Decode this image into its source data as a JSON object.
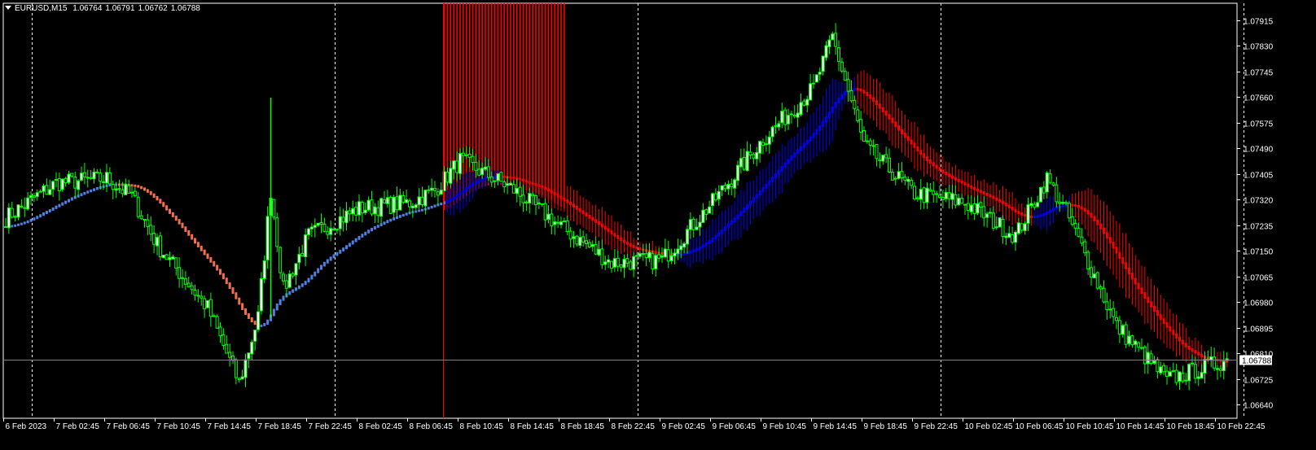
{
  "header": {
    "symbol": "EURUSD,M15",
    "open": "1.06764",
    "high": "1.06791",
    "low": "1.06762",
    "close": "1.06788"
  },
  "colors": {
    "background": "#000000",
    "bull_outline": "#00ff00",
    "bull_fill": "#ffffff",
    "ma_up": "#0000ff",
    "ma_down": "#ff0000",
    "ma_up_light": "#4f7fe0",
    "ma_down_light": "#f07050",
    "axis": "#ffffff",
    "current_line": "#808080",
    "signal_line": "#ff0000"
  },
  "chart_data": {
    "type": "candlestick",
    "title": "EURUSD,M15",
    "ylim": [
      1.0661,
      1.0799
    ],
    "y_ticks": [
      "1.07915",
      "1.07830",
      "1.07745",
      "1.07660",
      "1.07575",
      "1.07490",
      "1.07405",
      "1.07320",
      "1.07235",
      "1.07150",
      "1.07065",
      "1.06980",
      "1.06895",
      "1.06810",
      "1.06725",
      "1.06640"
    ],
    "current_price": "1.06788",
    "x_ticks": [
      "6 Feb 2023",
      "7 Feb 02:45",
      "7 Feb 06:45",
      "7 Feb 10:45",
      "7 Feb 14:45",
      "7 Feb 18:45",
      "7 Feb 22:45",
      "8 Feb 02:45",
      "8 Feb 06:45",
      "8 Feb 10:45",
      "8 Feb 14:45",
      "8 Feb 18:45",
      "8 Feb 22:45",
      "9 Feb 02:45",
      "9 Feb 06:45",
      "9 Feb 10:45",
      "9 Feb 14:45",
      "9 Feb 18:45",
      "9 Feb 22:45",
      "10 Feb 02:45",
      "10 Feb 06:45",
      "10 Feb 10:45",
      "10 Feb 14:45",
      "10 Feb 18:45",
      "10 Feb 22:45"
    ],
    "bars_per_tick": 16,
    "bar_count": 388,
    "day_separators_bar": [
      5,
      101,
      197,
      293,
      389
    ],
    "signal_bar": 138,
    "histogram_bars": [
      139,
      177
    ],
    "close_waypoints": [
      [
        0,
        1.0726
      ],
      [
        16,
        1.07375
      ],
      [
        32,
        1.0739
      ],
      [
        40,
        1.0733
      ],
      [
        48,
        1.0717
      ],
      [
        64,
        1.0696
      ],
      [
        74,
        1.0671
      ],
      [
        80,
        1.0693
      ],
      [
        84,
        1.0735
      ],
      [
        88,
        1.0702
      ],
      [
        96,
        1.072
      ],
      [
        112,
        1.0729
      ],
      [
        128,
        1.0731
      ],
      [
        136,
        1.0735
      ],
      [
        144,
        1.0745
      ],
      [
        160,
        1.0736
      ],
      [
        176,
        1.0723
      ],
      [
        192,
        1.0711
      ],
      [
        208,
        1.0712
      ],
      [
        224,
        1.0731
      ],
      [
        240,
        1.0752
      ],
      [
        256,
        1.0769
      ],
      [
        262,
        1.0786
      ],
      [
        272,
        1.075
      ],
      [
        288,
        1.0734
      ],
      [
        304,
        1.0731
      ],
      [
        320,
        1.072
      ],
      [
        330,
        1.0739
      ],
      [
        336,
        1.0728
      ],
      [
        352,
        1.069
      ],
      [
        368,
        1.0672
      ],
      [
        376,
        1.0675
      ],
      [
        387,
        1.06788
      ]
    ]
  }
}
